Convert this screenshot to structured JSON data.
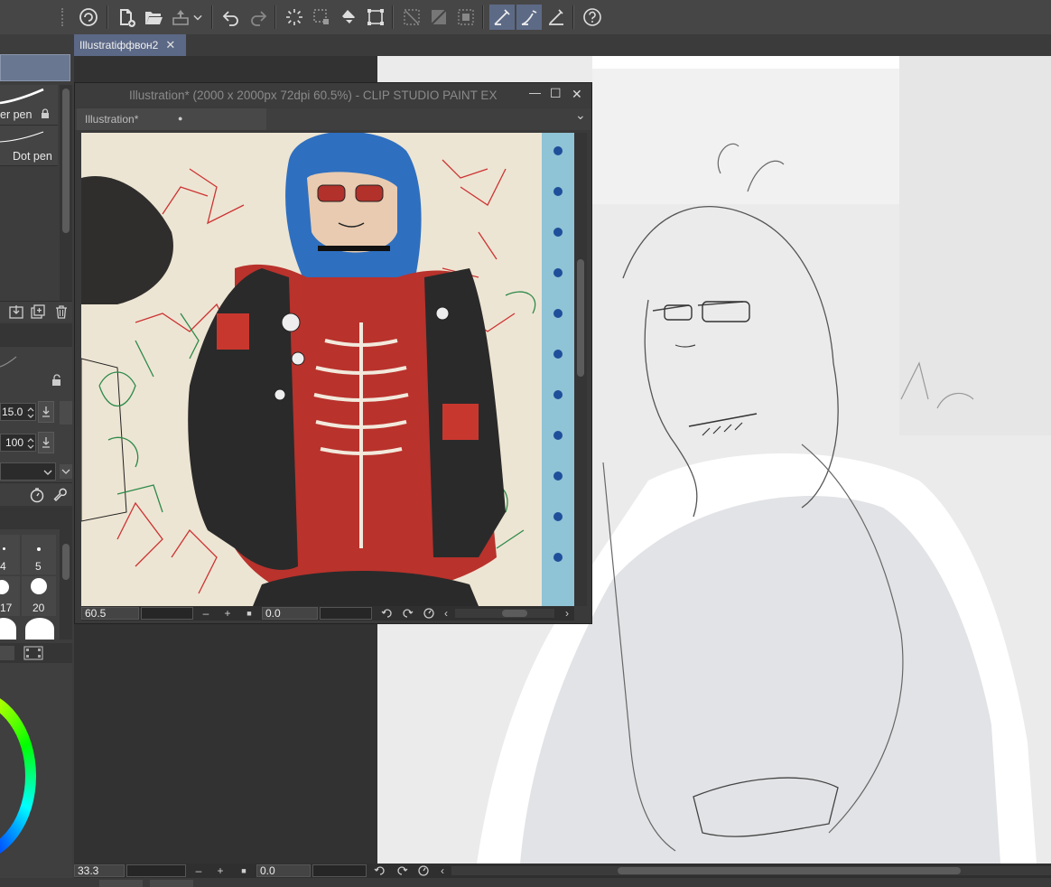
{
  "document_tab": {
    "label": "Illustratiффвон2",
    "close": "✕"
  },
  "sub_view": {
    "title": "Illustration* (2000 x 2000px 72dpi 60.5%)  - CLIP STUDIO PAINT EX",
    "tab_label": "Illustration*",
    "tab_dot": "●",
    "tab_dropdown": "⌄",
    "zoom": "60.5",
    "rotation": "0.0",
    "win_minimize": "—",
    "win_maximize": "☐",
    "win_close": "✕"
  },
  "brushes": [
    {
      "label": "er pen"
    },
    {
      "label": "Dot pen"
    }
  ],
  "tool_property": {
    "size_value": "15.0",
    "opacity_value": "100"
  },
  "brush_size_presets": [
    {
      "label": "4"
    },
    {
      "label": "5"
    },
    {
      "label": "17"
    },
    {
      "label": "20"
    }
  ],
  "main_status": {
    "zoom": "33.3",
    "rotation": "0.0"
  },
  "status_controls": {
    "minus": "–",
    "plus": "+",
    "stop": "■",
    "scroll_left": "‹",
    "scroll_right": "›"
  },
  "colors": {
    "accent": "#5d6a86",
    "panel": "#3f3f3f",
    "canvas": "#323232"
  }
}
